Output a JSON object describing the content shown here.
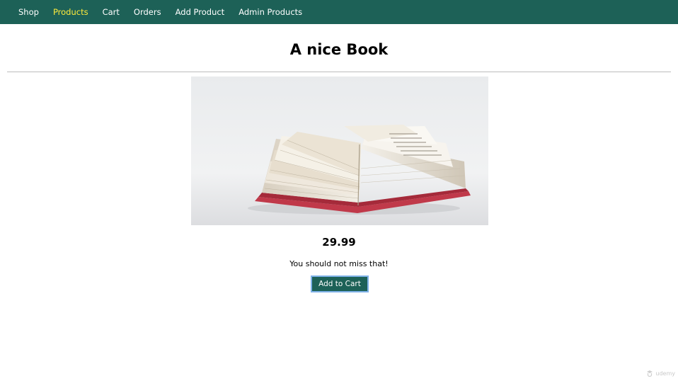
{
  "nav": {
    "items": [
      {
        "label": "Shop",
        "active": false
      },
      {
        "label": "Products",
        "active": true
      },
      {
        "label": "Cart",
        "active": false
      },
      {
        "label": "Orders",
        "active": false
      },
      {
        "label": "Add Product",
        "active": false
      },
      {
        "label": "Admin Products",
        "active": false
      }
    ]
  },
  "product": {
    "title": "A nice Book",
    "image": "open-book-photo",
    "price": "29.99",
    "description": "You should not miss that!",
    "add_to_cart_label": "Add to Cart"
  },
  "watermark": {
    "text": "udemy",
    "icon": "udemy-logo-icon"
  },
  "colors": {
    "nav_bg": "#1d6157",
    "nav_text": "#ffffff",
    "nav_active": "#ffeb3b",
    "button_bg": "#1d6157",
    "button_focus_ring": "#7fb2e8"
  }
}
